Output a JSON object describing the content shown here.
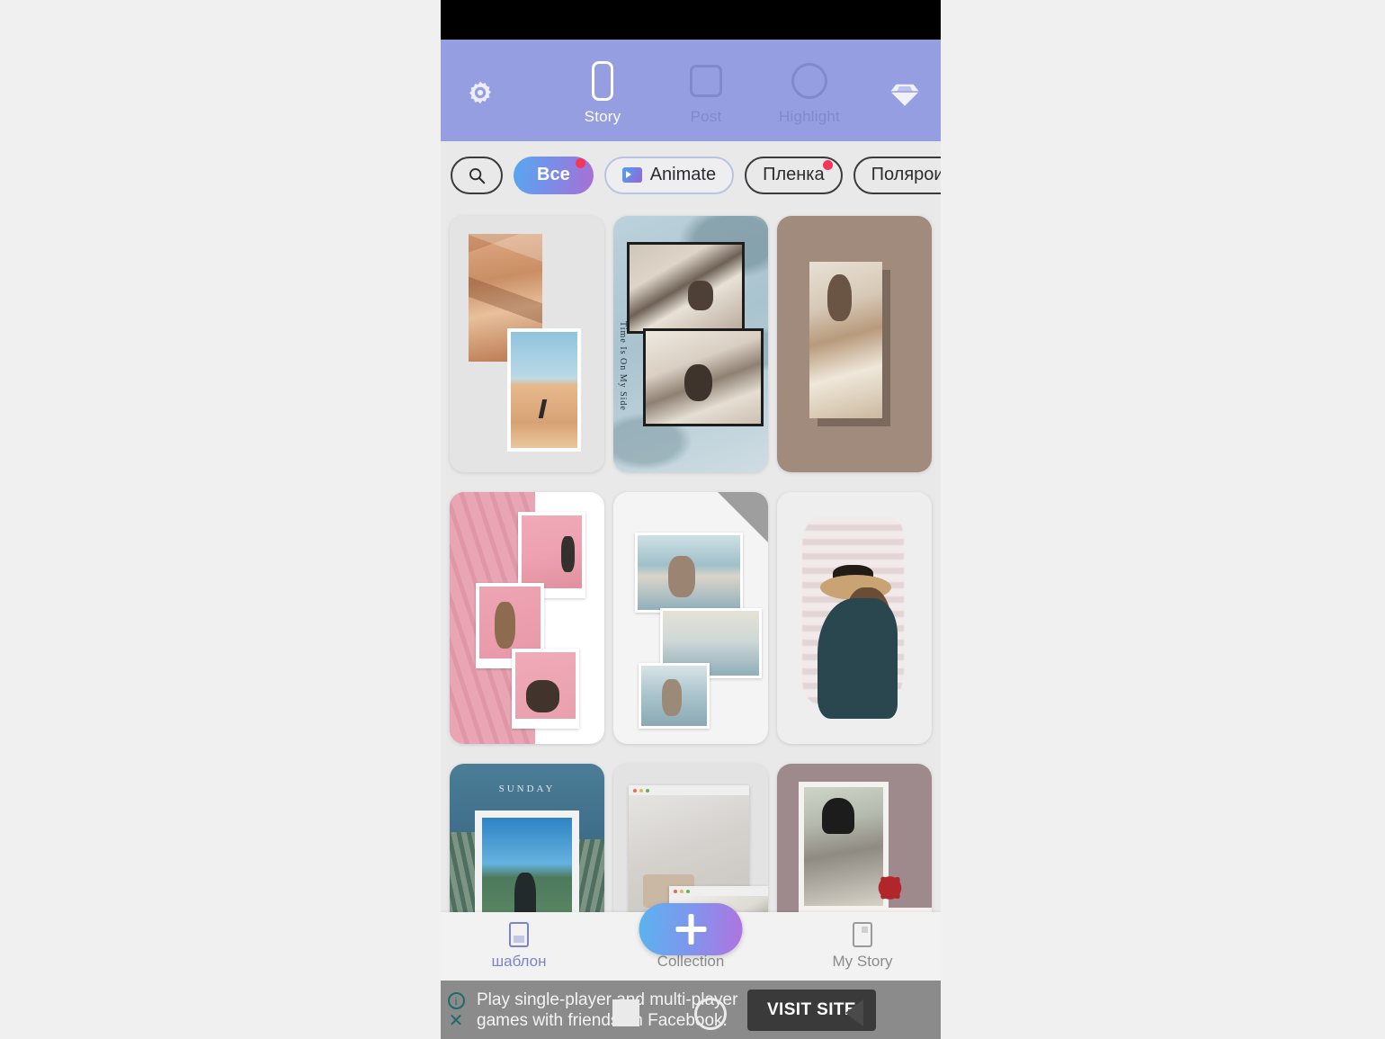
{
  "header": {
    "settings_icon": "gear-icon",
    "premium_icon": "diamond-icon",
    "modes": [
      {
        "label": "Story",
        "icon": "rounded-rect-icon",
        "active": true
      },
      {
        "label": "Post",
        "icon": "square-icon",
        "active": false
      },
      {
        "label": "Highlight",
        "icon": "circle-icon",
        "active": false
      }
    ],
    "purple": "#959ee0"
  },
  "filters": {
    "search_icon": "search-icon",
    "chips": [
      {
        "label": "Все",
        "active": true,
        "badge": true,
        "icon": null
      },
      {
        "label": "Animate",
        "active": false,
        "badge": false,
        "icon": "film-icon"
      },
      {
        "label": "Пленка",
        "active": false,
        "badge": true,
        "icon": null
      },
      {
        "label": "Полярои",
        "active": false,
        "badge": false,
        "icon": null
      }
    ],
    "active_gradient_from": "#56a8ef",
    "active_gradient_to": "#a86fd4",
    "badge_color": "#f4365a"
  },
  "templates": [
    {
      "name": "desert-dunes-collage",
      "caption": ""
    },
    {
      "name": "bedroom-time-is-on-my-side",
      "caption": "Time Is On My Side"
    },
    {
      "name": "taupe-framed-portrait",
      "caption": ""
    },
    {
      "name": "pink-polaroid-trio",
      "caption": ""
    },
    {
      "name": "beach-scarf-stack",
      "caption": ""
    },
    {
      "name": "hat-woman-watercolour",
      "caption": ""
    },
    {
      "name": "sunday-agave-frame",
      "caption": "SUNDAY"
    },
    {
      "name": "browser-window-mockup",
      "caption": ""
    },
    {
      "name": "mauve-polaroid-leaf",
      "caption": ""
    }
  ],
  "bottom_nav": {
    "items": [
      {
        "label": "шаблон",
        "icon": "template-icon",
        "active": true
      },
      {
        "label": "Collection",
        "icon": "bookmark-icon",
        "active": false
      },
      {
        "label": "My Story",
        "icon": "story-page-icon",
        "active": false
      }
    ],
    "create_button": {
      "icon": "plus-icon",
      "label": "+"
    },
    "active_color": "#7d84c5"
  },
  "ad": {
    "text": "Play single-player and multi-player games with friends on Facebook.",
    "cta": "VISIT SITE",
    "info_icon": "info-icon",
    "close_icon": "close-icon"
  }
}
